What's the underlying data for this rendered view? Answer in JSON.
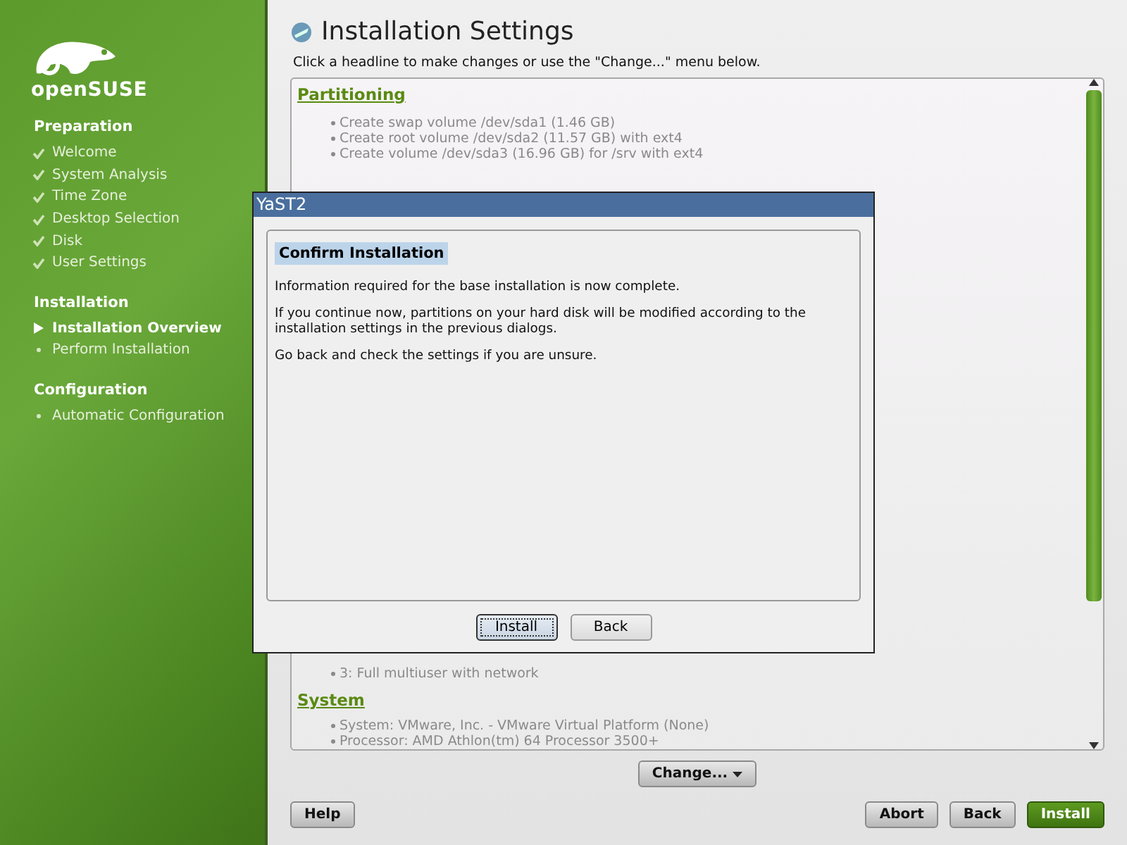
{
  "sidebar": {
    "logo_text": "openSUSE",
    "sections": [
      {
        "title": "Preparation",
        "items": [
          {
            "label": "Welcome",
            "done": true,
            "current": false
          },
          {
            "label": "System Analysis",
            "done": true,
            "current": false
          },
          {
            "label": "Time Zone",
            "done": true,
            "current": false
          },
          {
            "label": "Desktop Selection",
            "done": true,
            "current": false
          },
          {
            "label": "Disk",
            "done": true,
            "current": false
          },
          {
            "label": "User Settings",
            "done": true,
            "current": false
          }
        ]
      },
      {
        "title": "Installation",
        "items": [
          {
            "label": "Installation Overview",
            "done": false,
            "current": true
          },
          {
            "label": "Perform Installation",
            "done": false,
            "current": false
          }
        ]
      },
      {
        "title": "Configuration",
        "items": [
          {
            "label": "Automatic Configuration",
            "done": false,
            "current": false
          }
        ]
      }
    ]
  },
  "main": {
    "title": "Installation Settings",
    "hint": "Click a headline to make changes or use the \"Change...\" menu below.",
    "sections_top": [
      {
        "heading": "Partitioning",
        "bullets": [
          "Create swap volume /dev/sda1 (1.46 GB)",
          "Create root volume /dev/sda2 (11.57 GB) with ext4",
          "Create volume /dev/sda3 (16.96 GB) for /srv with ext4"
        ]
      }
    ],
    "sections_bottom": [
      {
        "bullets": [
          "3: Full multiuser with network"
        ]
      },
      {
        "heading": "System",
        "bullets": [
          "System: VMware, Inc. - VMware Virtual Platform (None)",
          "Processor: AMD Athlon(tm) 64 Processor 3500+"
        ]
      }
    ],
    "change_button": "Change...",
    "buttons_left": [
      "Help"
    ],
    "buttons_right": [
      {
        "label": "Abort",
        "primary": false
      },
      {
        "label": "Back",
        "primary": false
      },
      {
        "label": "Install",
        "primary": true
      }
    ]
  },
  "dialog": {
    "title": "YaST2",
    "heading": "Confirm Installation",
    "paragraphs": [
      "Information required for the base installation is now complete.",
      "If you continue now, partitions on your hard disk will be modified according to the installation settings in the previous dialogs.",
      "Go back and check the settings if you are unsure."
    ],
    "buttons": [
      {
        "label": "Install",
        "focused": true
      },
      {
        "label": "Back",
        "focused": false
      }
    ]
  }
}
